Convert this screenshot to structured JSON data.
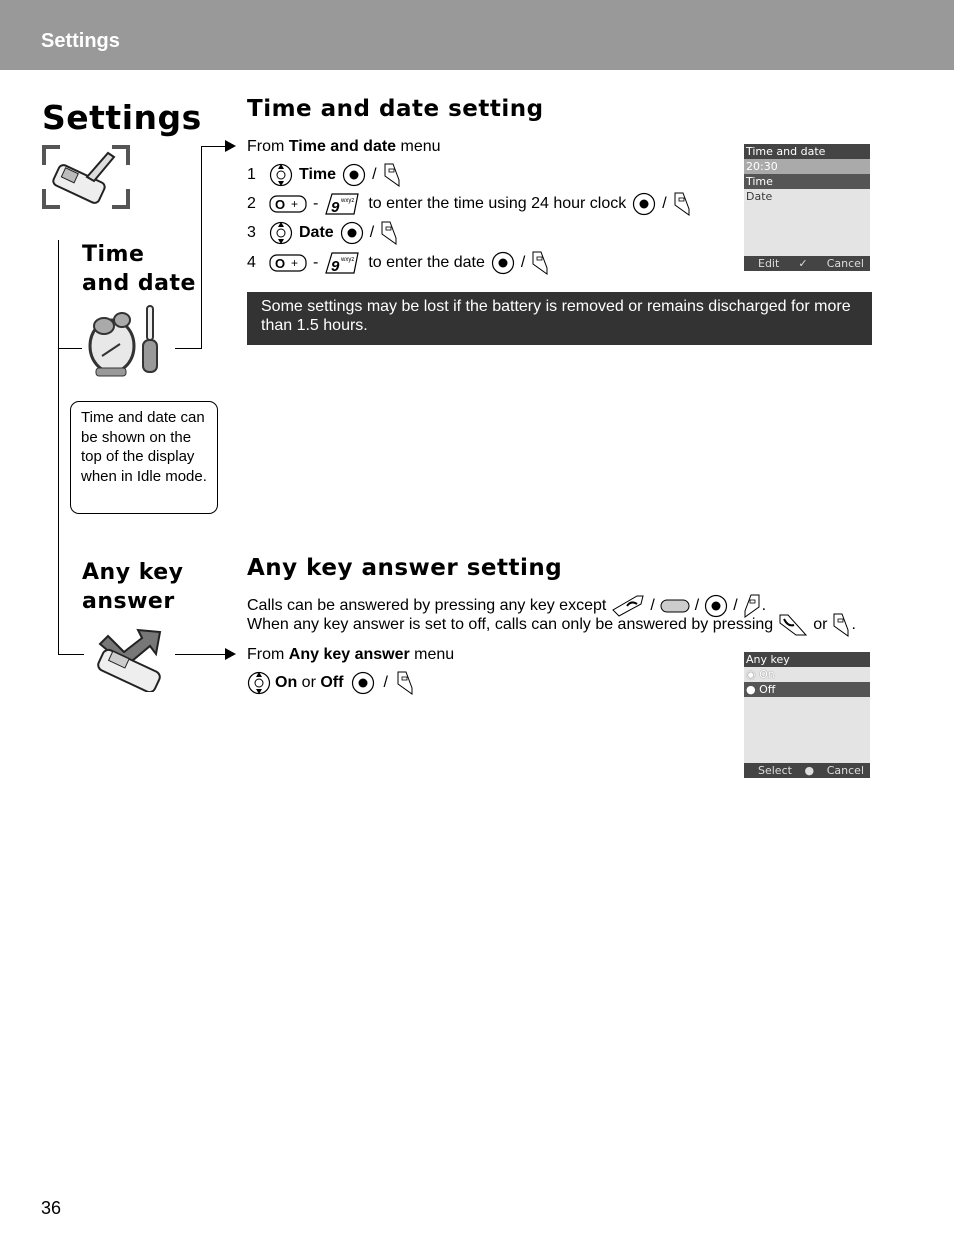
{
  "header": {
    "title": "Settings"
  },
  "page": {
    "title": "Settings",
    "number": "36"
  },
  "sidebar": {
    "time_date_label_line1": "Time",
    "time_date_label_line2": "and date",
    "callout": "Time and date can be shown on the top of the display when in Idle mode.",
    "any_key_label_line1": "Any key",
    "any_key_label_line2": "answer"
  },
  "time_date": {
    "title": "Time and date setting",
    "from_prefix": "From ",
    "from_menu": "Time and date",
    "from_suffix": " menu",
    "steps": [
      {
        "num": "1",
        "bold": "Time",
        "text": ""
      },
      {
        "num": "2",
        "bold": "",
        "text": "to enter the time using 24 hour clock"
      },
      {
        "num": "3",
        "bold": "Date",
        "text": ""
      },
      {
        "num": "4",
        "bold": "",
        "text": "to enter the date"
      }
    ],
    "dash": "-",
    "slash": "/",
    "note": "Some settings may be lost if the battery is removed or remains discharged for more than 1.5 hours.",
    "screen": {
      "title": "Time and date",
      "rows": [
        "20:30",
        "Time",
        "Date"
      ],
      "softkey_left": "Edit",
      "softkey_mid": "✓",
      "softkey_right": "Cancel"
    }
  },
  "any_key": {
    "title": "Any key answer setting",
    "line1": "Calls can be answered by pressing any key except",
    "line2": "When any key answer is set to off, calls can only be answered by pressing",
    "or": "or",
    "period": ".",
    "slash": "/",
    "from_prefix": "From ",
    "from_menu": "Any key answer",
    "from_suffix": " menu",
    "option_on": "On",
    "option_or": " or ",
    "option_off": "Off",
    "screen": {
      "title": "Any key",
      "rows": [
        "On",
        "Off"
      ],
      "softkey_left": "Select",
      "softkey_mid": "●",
      "softkey_right": "Cancel"
    }
  }
}
